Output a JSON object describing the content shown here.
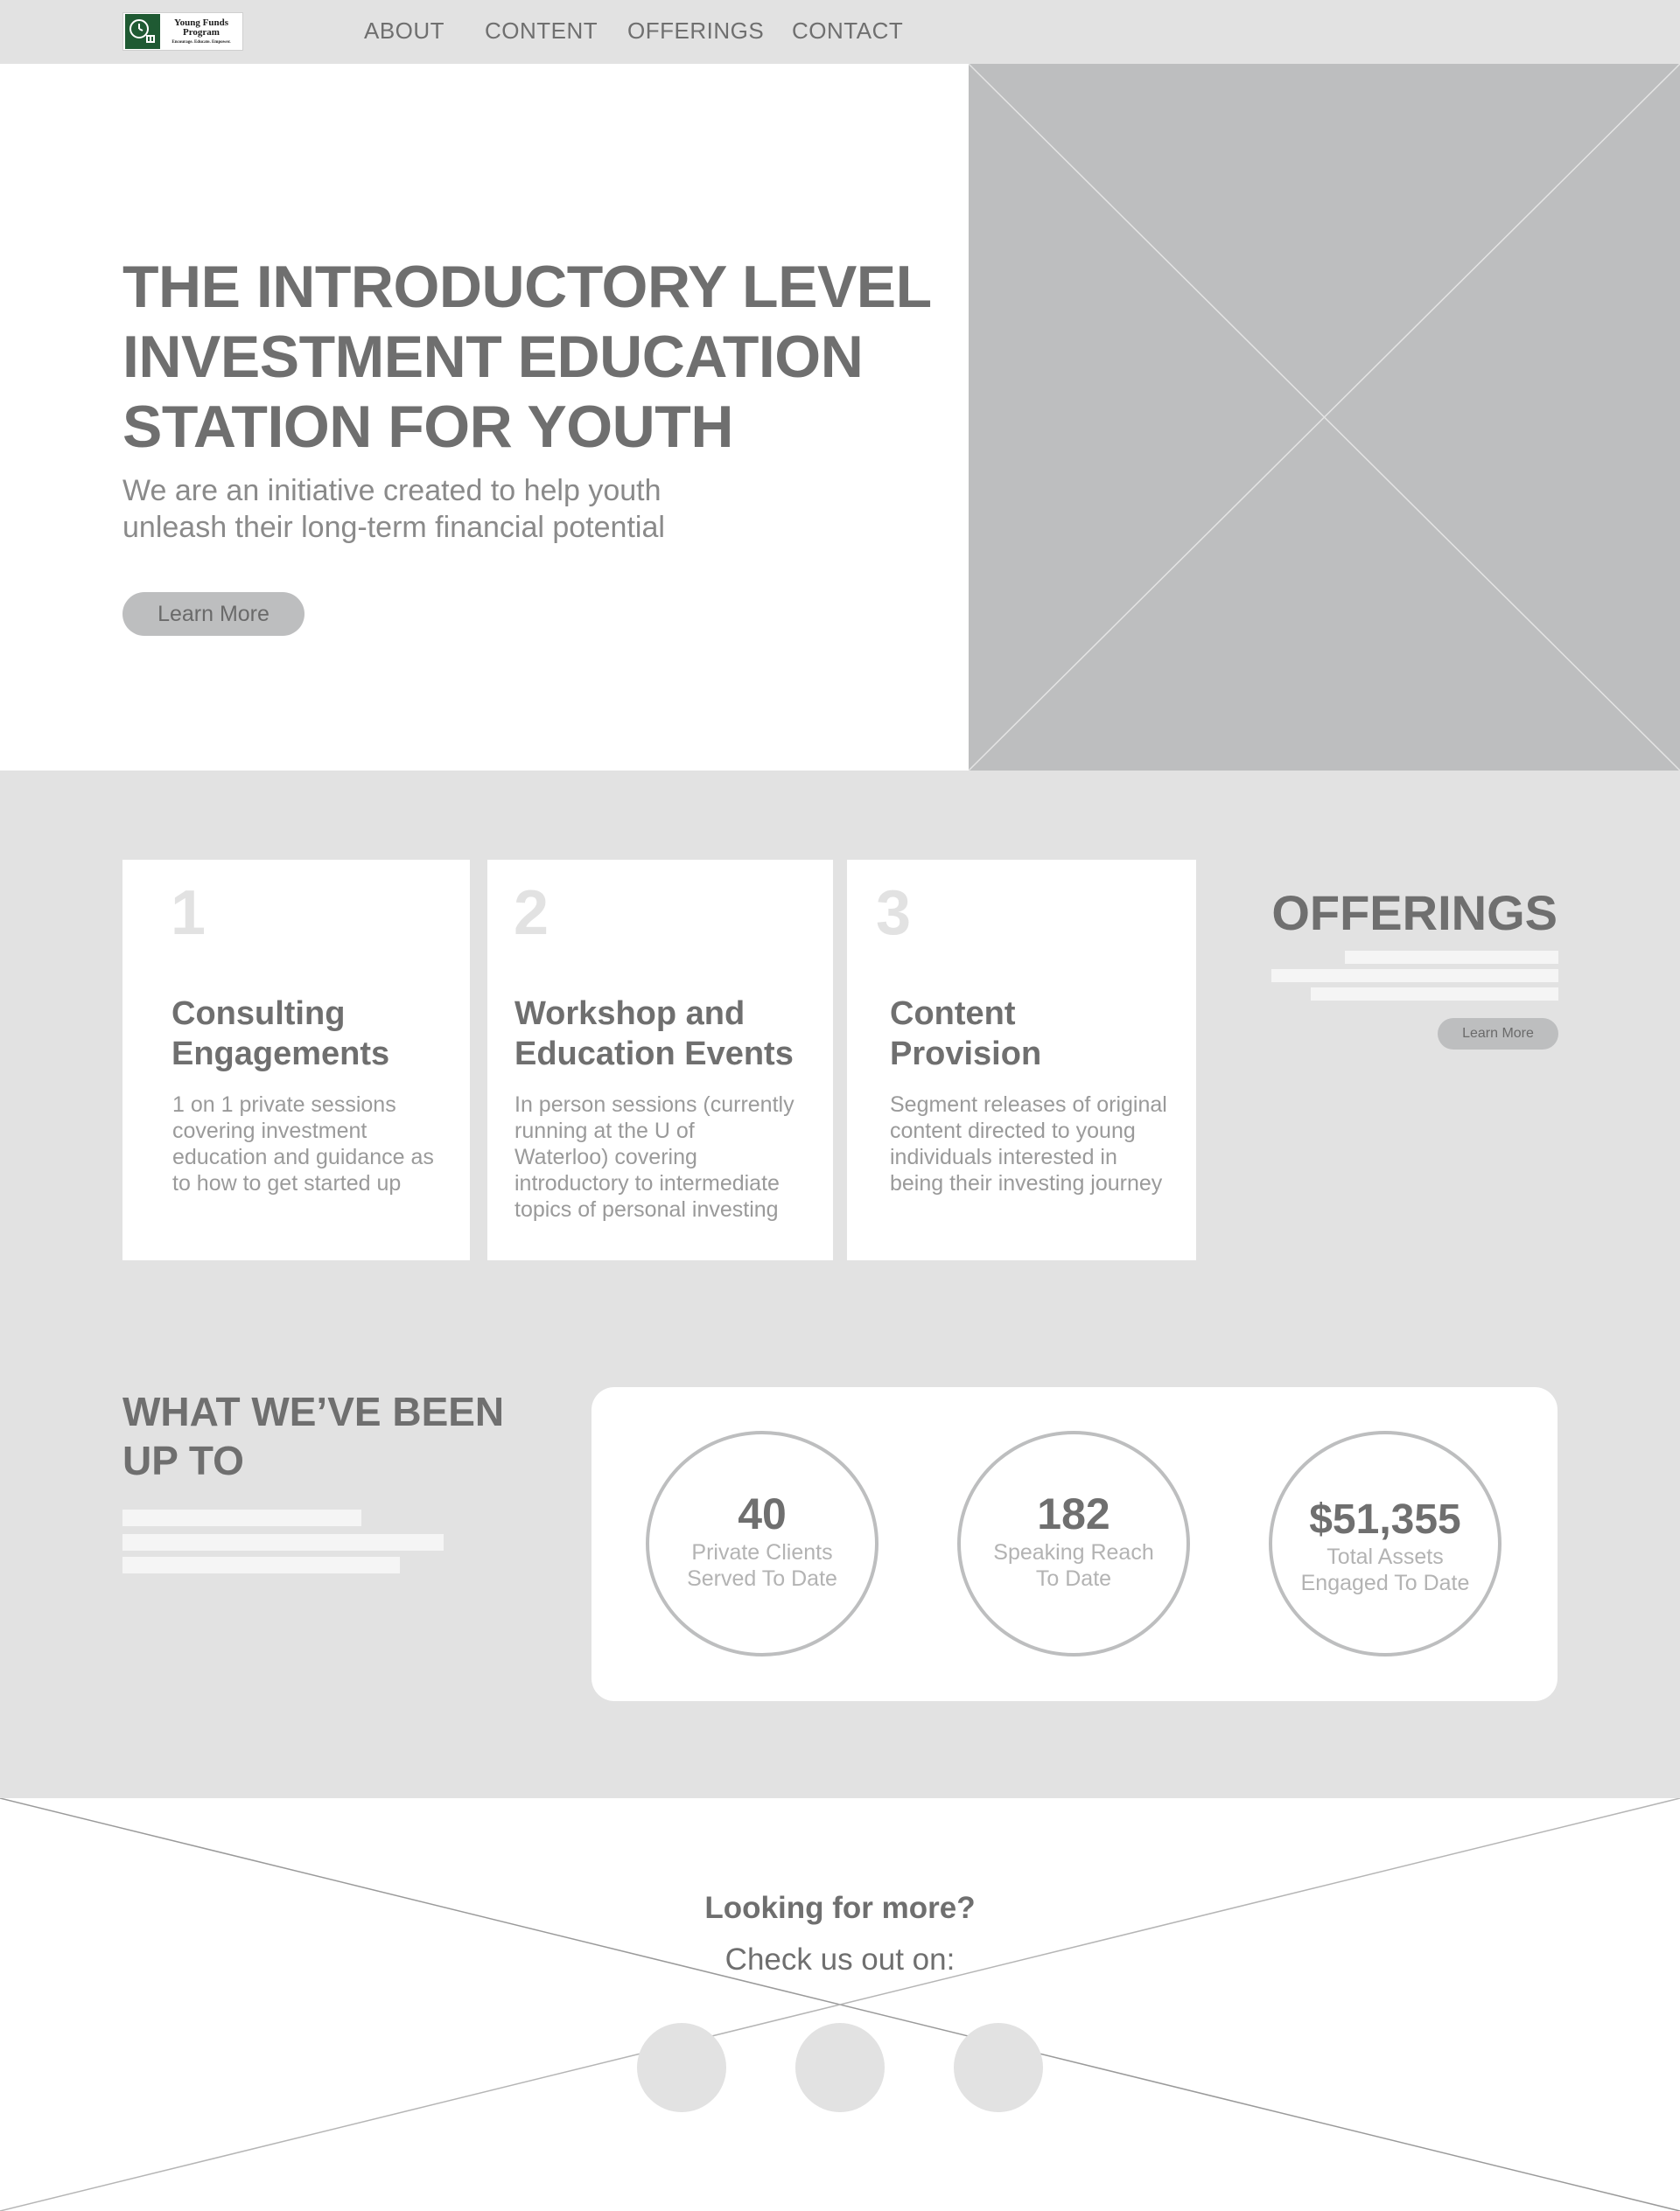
{
  "logo": {
    "name": "Young Funds Program",
    "tagline": "Encourage. Educate. Empower."
  },
  "nav": {
    "about": "ABOUT",
    "content": "CONTENT",
    "offerings": "OFFERINGS",
    "contact": "CONTACT"
  },
  "hero": {
    "title": "THE INTRODUCTORY LEVEL INVESTMENT EDUCATION STATION FOR YOUTH",
    "subtitle": "We are an initiative created to help youth unleash their long-term financial potential",
    "button": "Learn More"
  },
  "offerings": {
    "title": "OFFERINGS",
    "button": "Learn More",
    "cards": [
      {
        "number": "1",
        "title": "Consulting Engagements",
        "description": "1 on 1 private sessions covering investment education and guidance as to how to get started up"
      },
      {
        "number": "2",
        "title": "Workshop and Education Events",
        "description": "In person sessions (currently running at the U of Waterloo) covering introductory to intermediate topics of personal investing"
      },
      {
        "number": "3",
        "title": "Content Provision",
        "description": "Segment releases of original content directed to young individuals interested in being their investing journey"
      }
    ]
  },
  "stats": {
    "title": "WHAT WE’VE BEEN UP TO",
    "items": [
      {
        "value": "40",
        "label": "Private Clients Served To Date"
      },
      {
        "value": "182",
        "label": "Speaking Reach To Date"
      },
      {
        "value": "$51,355",
        "label": "Total Assets Engaged To Date"
      }
    ]
  },
  "footer": {
    "question": "Looking for more?",
    "subtitle": "Check us out on:"
  }
}
